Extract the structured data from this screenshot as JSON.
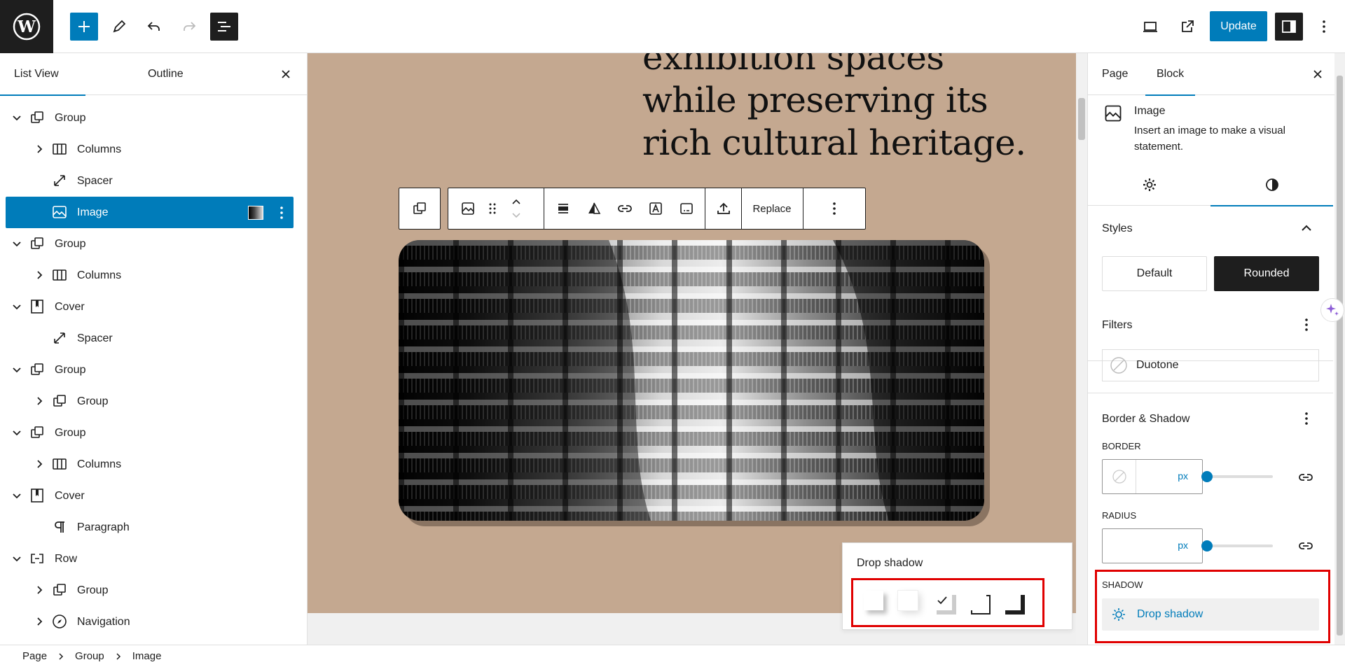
{
  "topbar": {
    "update_label": "Update"
  },
  "list_view": {
    "tabs": [
      {
        "label": "List View",
        "active": true
      },
      {
        "label": "Outline",
        "active": false
      }
    ],
    "rows": [
      {
        "label": "Group",
        "icon": "group-icon",
        "level": 0,
        "expander": "down"
      },
      {
        "label": "Columns",
        "icon": "columns-icon",
        "level": 1,
        "expander": "right"
      },
      {
        "label": "Spacer",
        "icon": "spacer-icon",
        "level": 1,
        "expander": "none"
      },
      {
        "label": "Image",
        "icon": "image-icon",
        "level": 1,
        "expander": "none",
        "selected": true
      },
      {
        "label": "Group",
        "icon": "group-icon",
        "level": 0,
        "expander": "down"
      },
      {
        "label": "Columns",
        "icon": "columns-icon",
        "level": 1,
        "expander": "right"
      },
      {
        "label": "Cover",
        "icon": "cover-icon",
        "level": 0,
        "expander": "down"
      },
      {
        "label": "Spacer",
        "icon": "spacer-icon",
        "level": 1,
        "expander": "none"
      },
      {
        "label": "Group",
        "icon": "group-icon",
        "level": 0,
        "expander": "down"
      },
      {
        "label": "Group",
        "icon": "group-icon",
        "level": 1,
        "expander": "right"
      },
      {
        "label": "Group",
        "icon": "group-icon",
        "level": 0,
        "expander": "down"
      },
      {
        "label": "Columns",
        "icon": "columns-icon",
        "level": 1,
        "expander": "right"
      },
      {
        "label": "Cover",
        "icon": "cover-icon",
        "level": 0,
        "expander": "down"
      },
      {
        "label": "Paragraph",
        "icon": "paragraph-icon",
        "level": 1,
        "expander": "none"
      },
      {
        "label": "Row",
        "icon": "row-icon",
        "level": 0,
        "expander": "down"
      },
      {
        "label": "Group",
        "icon": "group-icon",
        "level": 1,
        "expander": "right"
      },
      {
        "label": "Navigation",
        "icon": "navigation-icon",
        "level": 1,
        "expander": "right"
      }
    ]
  },
  "canvas": {
    "heading_text": "exhibition spaces while preserving its rich cultural heritage.",
    "toolbar": {
      "replace_label": "Replace"
    },
    "shadow_popover": {
      "title": "Drop shadow",
      "presets": [
        "natural",
        "deep",
        "sharp",
        "outlined",
        "crisp"
      ],
      "selected_index": 2
    }
  },
  "settings": {
    "tabs": [
      {
        "label": "Page",
        "active": false
      },
      {
        "label": "Block",
        "active": true
      }
    ],
    "block": {
      "name": "Image",
      "description": "Insert an image to make a visual statement."
    },
    "styles": {
      "title": "Styles",
      "options": [
        {
          "label": "Default",
          "active": false
        },
        {
          "label": "Rounded",
          "active": true
        }
      ]
    },
    "filters": {
      "title": "Filters",
      "duotone_label": "Duotone"
    },
    "border_shadow": {
      "title": "Border & Shadow",
      "border_label": "BORDER",
      "border_unit": "px",
      "border_value": "",
      "radius_label": "RADIUS",
      "radius_unit": "px",
      "radius_value": "",
      "shadow_label": "SHADOW",
      "shadow_button": "Drop shadow"
    }
  },
  "breadcrumb": [
    "Page",
    "Group",
    "Image"
  ],
  "colors": {
    "accent": "#007cba",
    "canvas_bg": "#c4a890",
    "highlight": "#e00000",
    "dark": "#1e1e1e"
  }
}
